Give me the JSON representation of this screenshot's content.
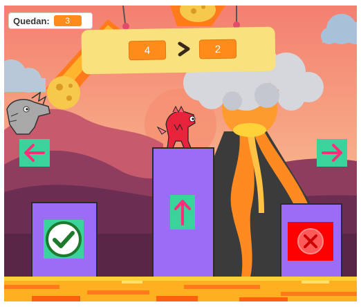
{
  "counter": {
    "label": "Quedan:",
    "value": "3"
  },
  "puzzle": {
    "left_value": "4",
    "right_value": "2"
  },
  "colors": {
    "sky": "#f2a07a",
    "platform": "#9b6cf5",
    "button": "#39d39b",
    "button_icon": "#ff2d7a",
    "counter_accent": "#ff8c1a",
    "panel": "#f9e27e",
    "lava": "#ffb020",
    "error": "#ff0000"
  },
  "icons": {
    "move_left": "arrow-left-icon",
    "move_right": "arrow-right-icon",
    "jump": "arrow-up-icon",
    "correct": "checkmark-icon",
    "wrong": "cross-icon",
    "compare": "greater-than-icon"
  }
}
